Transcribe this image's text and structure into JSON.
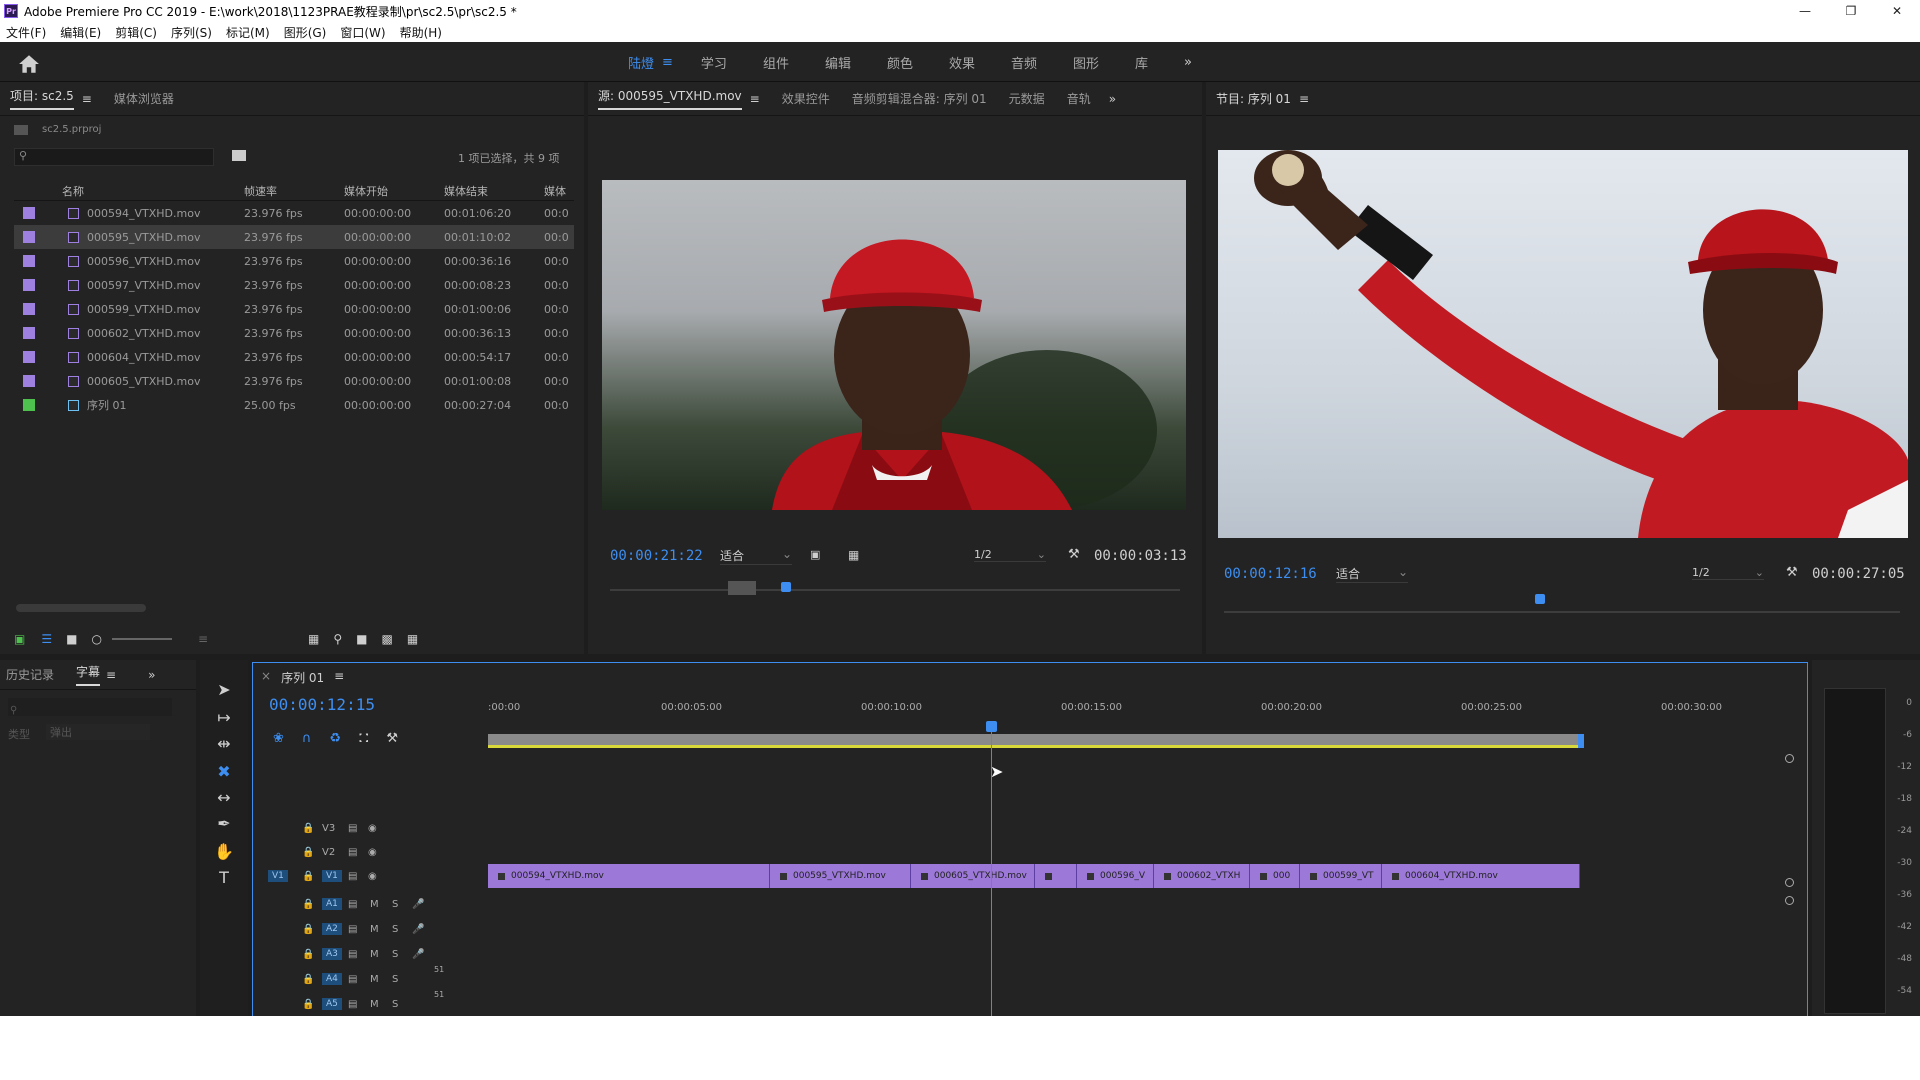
{
  "window": {
    "title": "Adobe Premiere Pro CC 2019 - E:\\work\\2018\\1123PRAE教程录制\\pr\\sc2.5\\pr\\sc2.5 *",
    "icon_label": "Pr"
  },
  "menu": [
    "文件(F)",
    "编辑(E)",
    "剪辑(C)",
    "序列(S)",
    "标记(M)",
    "图形(G)",
    "窗口(W)",
    "帮助(H)"
  ],
  "workspaces": {
    "items": [
      "陆燈",
      "学习",
      "组件",
      "编辑",
      "颜色",
      "效果",
      "音频",
      "图形",
      "库"
    ],
    "active_index": 0
  },
  "project_panel": {
    "tabs": [
      "项目: sc2.5",
      "媒体浏览器"
    ],
    "file": "sc2.5.prproj",
    "selection_info": "1 项已选择，共 9 项",
    "columns": [
      "名称",
      "帧速率",
      "媒体开始",
      "媒体结束",
      "媒体"
    ],
    "rows": [
      {
        "name": "000594_VTXHD.mov",
        "fps": "23.976 fps",
        "start": "00:00:00:00",
        "end": "00:01:06:20",
        "dur": "00:0",
        "color": "#9d80e0",
        "selected": false
      },
      {
        "name": "000595_VTXHD.mov",
        "fps": "23.976 fps",
        "start": "00:00:00:00",
        "end": "00:01:10:02",
        "dur": "00:0",
        "color": "#9d80e0",
        "selected": true
      },
      {
        "name": "000596_VTXHD.mov",
        "fps": "23.976 fps",
        "start": "00:00:00:00",
        "end": "00:00:36:16",
        "dur": "00:0",
        "color": "#9d80e0",
        "selected": false
      },
      {
        "name": "000597_VTXHD.mov",
        "fps": "23.976 fps",
        "start": "00:00:00:00",
        "end": "00:00:08:23",
        "dur": "00:0",
        "color": "#9d80e0",
        "selected": false
      },
      {
        "name": "000599_VTXHD.mov",
        "fps": "23.976 fps",
        "start": "00:00:00:00",
        "end": "00:01:00:06",
        "dur": "00:0",
        "color": "#9d80e0",
        "selected": false
      },
      {
        "name": "000602_VTXHD.mov",
        "fps": "23.976 fps",
        "start": "00:00:00:00",
        "end": "00:00:36:13",
        "dur": "00:0",
        "color": "#9d80e0",
        "selected": false
      },
      {
        "name": "000604_VTXHD.mov",
        "fps": "23.976 fps",
        "start": "00:00:00:00",
        "end": "00:00:54:17",
        "dur": "00:0",
        "color": "#9d80e0",
        "selected": false
      },
      {
        "name": "000605_VTXHD.mov",
        "fps": "23.976 fps",
        "start": "00:00:00:00",
        "end": "00:01:00:08",
        "dur": "00:0",
        "color": "#9d80e0",
        "selected": false
      },
      {
        "name": "序列 01",
        "fps": "25.00 fps",
        "start": "00:00:00:00",
        "end": "00:00:27:04",
        "dur": "00:0",
        "color": "#4ec04e",
        "selected": false
      }
    ]
  },
  "source_monitor": {
    "tabs": [
      "源: 000595_VTXHD.mov",
      "效果控件",
      "音频剪辑混合器: 序列 01",
      "元数据",
      "音轨"
    ],
    "timecode": "00:00:21:22",
    "fit": "适合",
    "resolution": "1/2",
    "duration": "00:00:03:13",
    "playhead_fraction": 0.3
  },
  "program_monitor": {
    "tabs": [
      "节目: 序列 01"
    ],
    "timecode": "00:00:12:16",
    "fit": "适合",
    "resolution": "1/2",
    "duration": "00:00:27:05",
    "playhead_fraction": 0.46
  },
  "history_panel": {
    "tabs": [
      "历史记录",
      "字幕"
    ],
    "type_label": "类型",
    "type_value": "弹出"
  },
  "timeline": {
    "tab": "序列 01",
    "timecode": "00:00:12:15",
    "ruler": [
      ":00:00",
      "00:00:05:00",
      "00:00:10:00",
      "00:00:15:00",
      "00:00:20:00",
      "00:00:25:00",
      "00:00:30:00"
    ],
    "video_tracks": [
      "V3",
      "V2",
      "V1"
    ],
    "audio_tracks": [
      "A1",
      "A2",
      "A3",
      "A4",
      "A5"
    ],
    "source_patch": "V1",
    "audio_m": "M",
    "audio_s": "S",
    "audio_level": "51",
    "clips": [
      "000594_VTXHD.mov",
      "000595_VTXHD.mov",
      "000605_VTXHD.mov",
      "",
      "000596_V",
      "000602_VTXH",
      "000",
      "000599_VT",
      "000604_VTXHD.mov"
    ]
  },
  "meter_scale": [
    "0",
    "-6",
    "-12",
    "-18",
    "-24",
    "-30",
    "-36",
    "-42",
    "-48",
    "-54"
  ]
}
